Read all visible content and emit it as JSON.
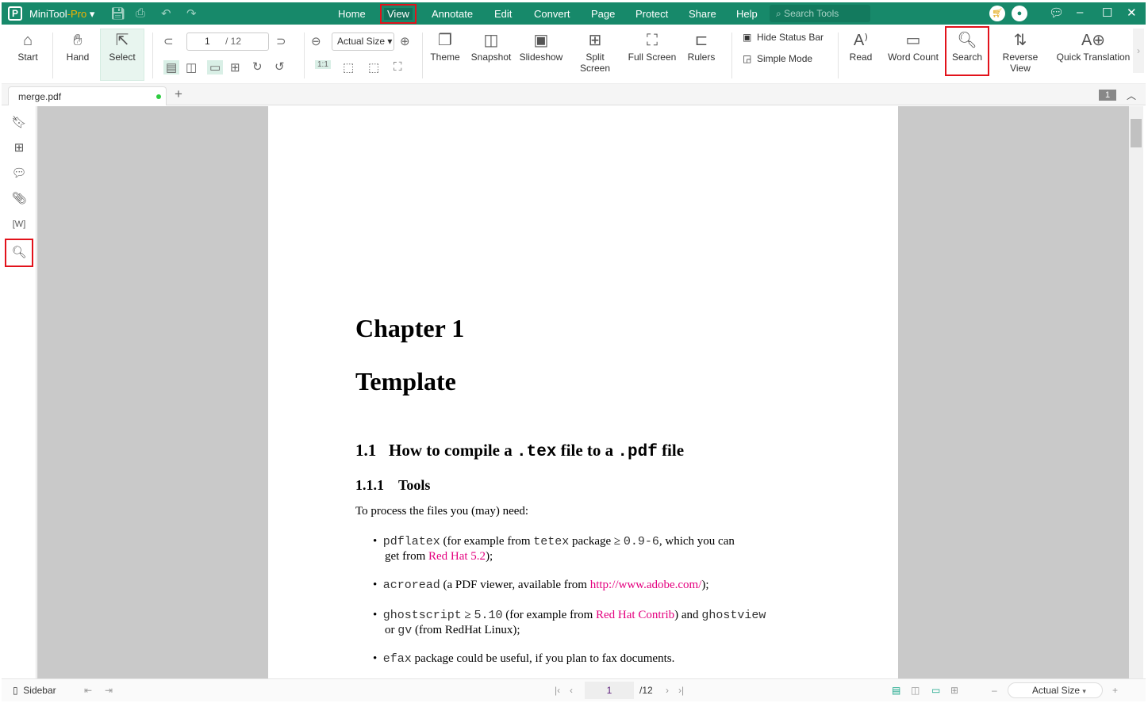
{
  "app": {
    "name": "MiniTool",
    "edition": "-Pro"
  },
  "menu": [
    "Home",
    "View",
    "Annotate",
    "Edit",
    "Convert",
    "Page",
    "Protect",
    "Share",
    "Help"
  ],
  "search_tools_placeholder": "Search Tools",
  "ribbon": {
    "start": "Start",
    "hand": "Hand",
    "select": "Select",
    "page_current": "1",
    "page_total": "/ 12",
    "zoom": "Actual Size",
    "theme": "Theme",
    "snapshot": "Snapshot",
    "slideshow": "Slideshow",
    "split_screen": "Split Screen",
    "full_screen": "Full Screen",
    "rulers": "Rulers",
    "hide_status_bar": "Hide Status Bar",
    "simple_mode": "Simple Mode",
    "read": "Read",
    "word_count": "Word Count",
    "search": "Search",
    "reverse_view": "Reverse View",
    "quick_translation": "Quick Translation"
  },
  "tabs": [
    {
      "label": "merge.pdf"
    }
  ],
  "tab_count": "1",
  "doc": {
    "chapter": "Chapter 1",
    "title": "Template",
    "s1_num": "1.1",
    "s1_a": "How to compile a ",
    "s1_b": ".tex",
    "s1_c": " file to a ",
    "s1_d": ".pdf",
    "s1_e": " file",
    "s2_num": "1.1.1",
    "s2": "Tools",
    "intro": "To process the files you (may) need:",
    "b1": [
      "pdflatex",
      " (for example from ",
      "tetex",
      " package ≥ ",
      "0.9-6",
      ", which you can",
      "get from ",
      "Red Hat 5.2",
      ");"
    ],
    "b2": [
      "acroread",
      " (a PDF viewer, available from ",
      "http://www.adobe.com/",
      ");"
    ],
    "b3": [
      "ghostscript",
      " ≥ ",
      "5.10",
      " (for example from ",
      "Red Hat Contrib",
      ") and ",
      "ghostview",
      "or ",
      "gv",
      " (from RedHat Linux);"
    ],
    "b4": [
      "efax",
      " package could be useful, if you plan to fax documents."
    ]
  },
  "status": {
    "sidebar": "Sidebar",
    "page": "1",
    "total": "/12",
    "zoom": "Actual Size"
  }
}
